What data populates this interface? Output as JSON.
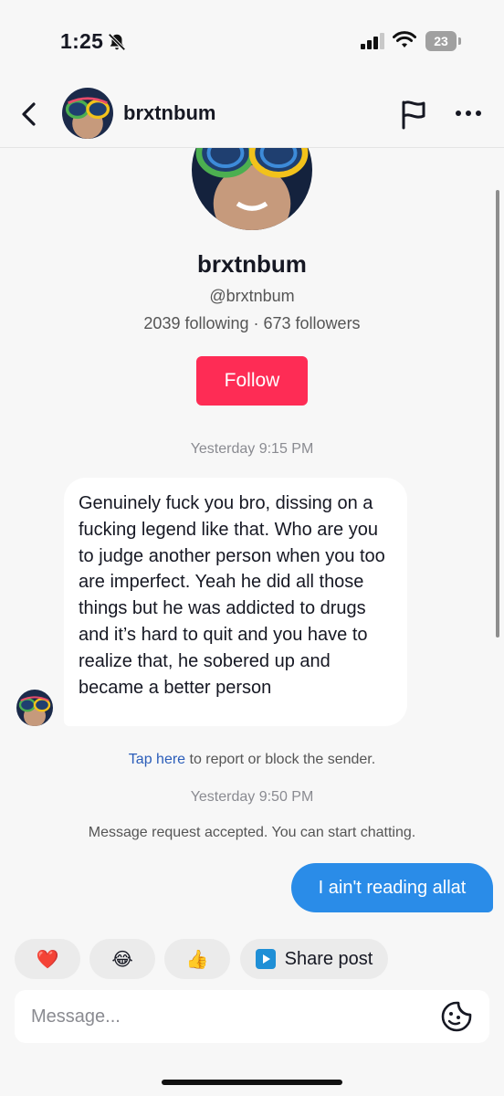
{
  "status_bar": {
    "time": "1:25",
    "battery": "23"
  },
  "header": {
    "username": "brxtnbum"
  },
  "profile": {
    "display_name": "brxtnbum",
    "handle": "@brxtnbum",
    "stats": "2039 following · 673 followers",
    "follow_label": "Follow"
  },
  "messages": {
    "timestamp_1": "Yesterday 9:15 PM",
    "incoming_text": "Genuinely fuck you bro, dissing on a fucking legend like that. Who are you to judge another person when you too are imperfect. Yeah he did all those things but he was addicted to drugs and it’s hard to quit and you have to realize that, he sobered up and became a better person",
    "report_link": "Tap here",
    "report_rest": " to report or block the sender.",
    "timestamp_2": "Yesterday 9:50 PM",
    "accepted_notice": "Message request accepted. You can start chatting.",
    "outgoing_text": "I ain't reading allat"
  },
  "quick_replies": {
    "heart": "❤️",
    "laugh": "😂",
    "thumbs": "👍",
    "share_label": "Share post"
  },
  "composer": {
    "placeholder": "Message..."
  },
  "colors": {
    "follow": "#fe2c55",
    "outgoing_bubble": "#2a8ce8",
    "link": "#2b5db9"
  },
  "icons": [
    "bell-slash-icon",
    "signal-icon",
    "wifi-icon",
    "battery-icon",
    "back-icon",
    "flag-icon",
    "more-icon",
    "share-post-icon",
    "sticker-icon"
  ]
}
